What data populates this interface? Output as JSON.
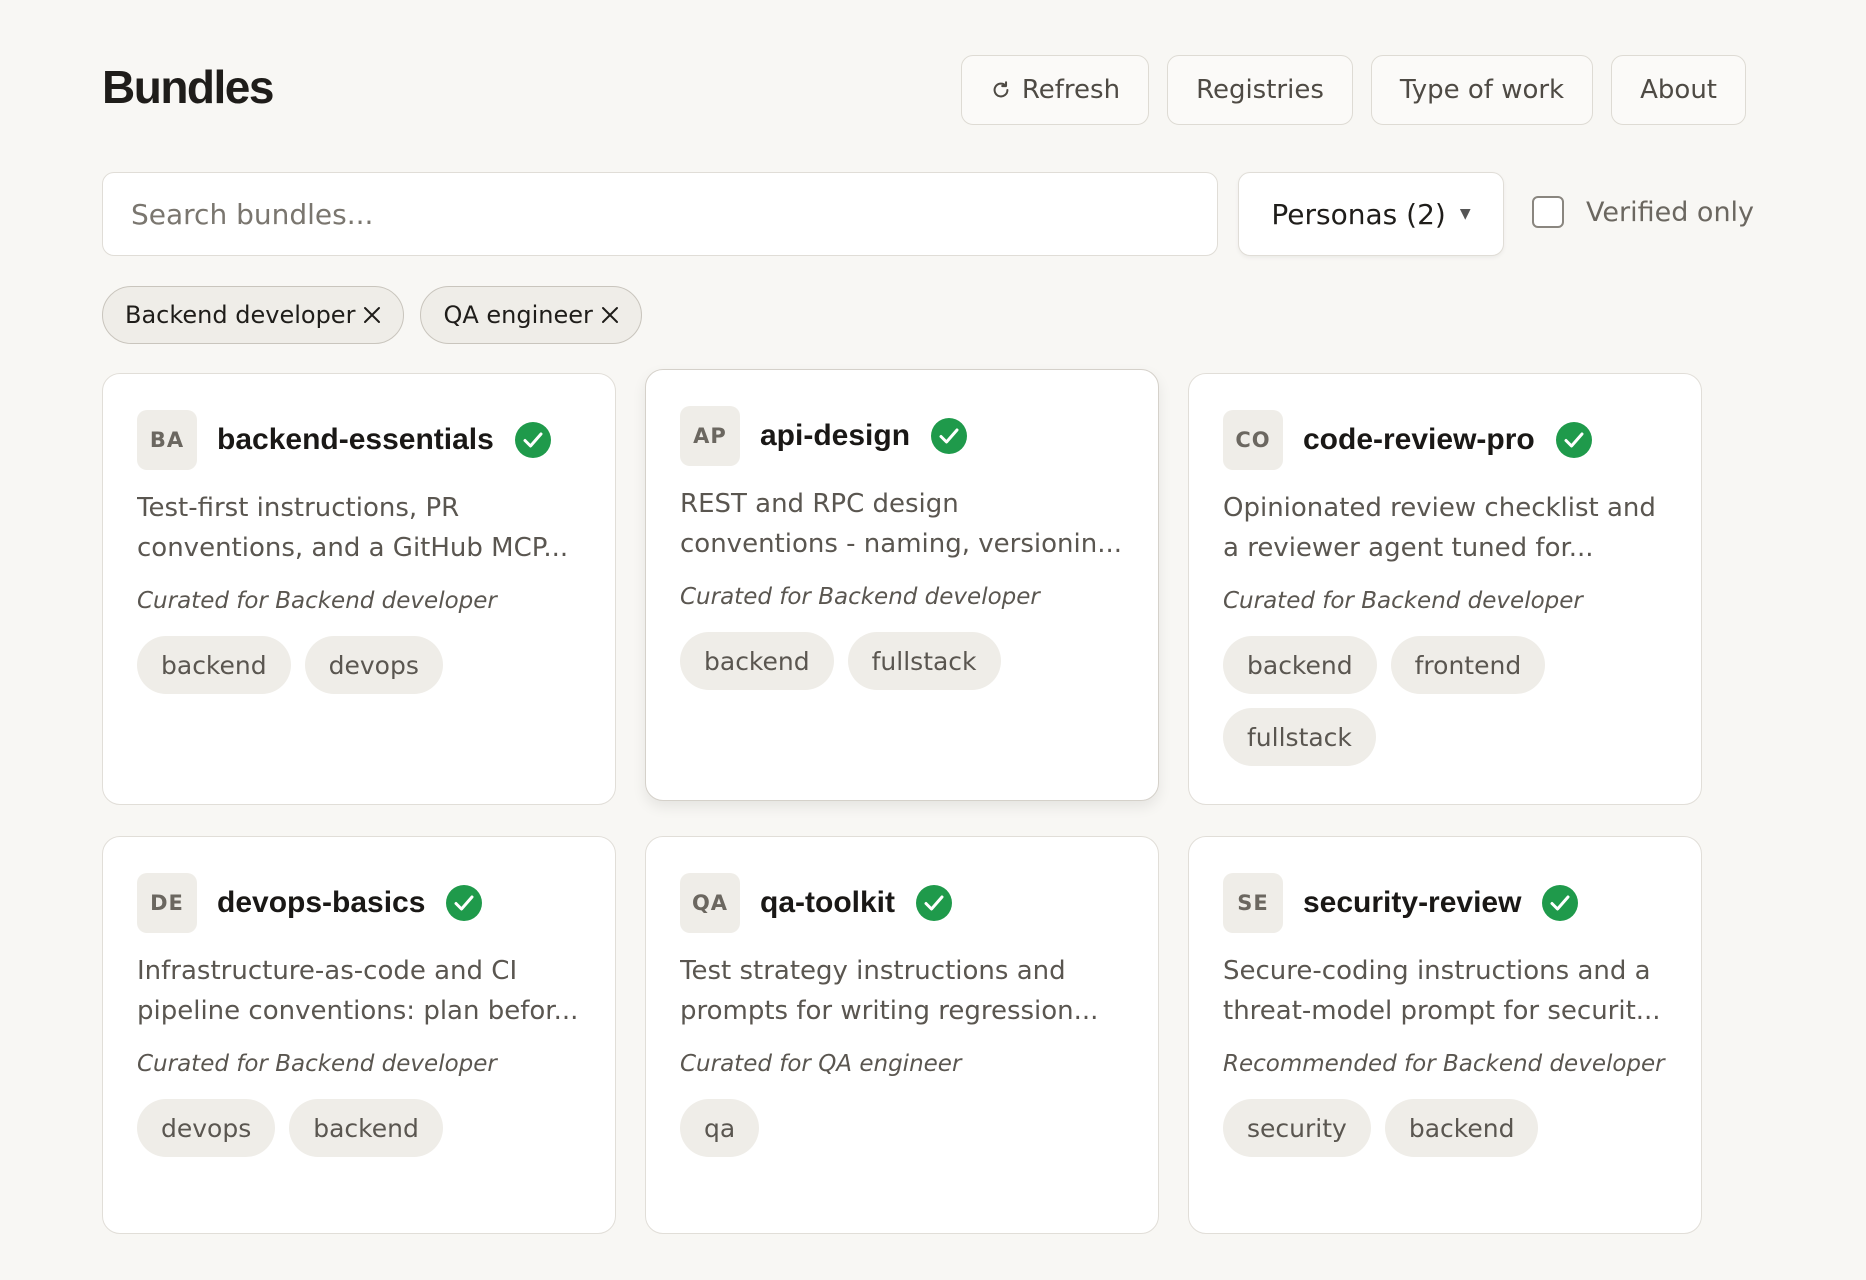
{
  "header": {
    "title": "Bundles",
    "buttons": {
      "refresh": "Refresh",
      "registries": "Registries",
      "type_of_work": "Type of work",
      "about": "About"
    }
  },
  "filters": {
    "search_placeholder": "Search bundles...",
    "personas_label": "Personas (2)",
    "verified_only_label": "Verified only",
    "verified_only_checked": false,
    "active_chips": [
      "Backend developer",
      "QA engineer"
    ]
  },
  "colors": {
    "verified_green": "#1f9a4b",
    "background": "#f8f7f4"
  },
  "bundles": [
    {
      "initials": "BA",
      "name": "backend-essentials",
      "verified": true,
      "description": "Test-first instructions, PR conventions, and a GitHub MCP...",
      "curated": "Curated for Backend developer",
      "tags": [
        "backend",
        "devops"
      ]
    },
    {
      "initials": "AP",
      "name": "api-design",
      "verified": true,
      "description": "REST and RPC design conventions - naming, versionin...",
      "curated": "Curated for Backend developer",
      "tags": [
        "backend",
        "fullstack"
      ]
    },
    {
      "initials": "CO",
      "name": "code-review-pro",
      "verified": true,
      "description": "Opinionated review checklist and a reviewer agent tuned for...",
      "curated": "Curated for Backend developer",
      "tags": [
        "backend",
        "frontend",
        "fullstack"
      ]
    },
    {
      "initials": "DE",
      "name": "devops-basics",
      "verified": true,
      "description": "Infrastructure-as-code and CI pipeline conventions: plan befor...",
      "curated": "Curated for Backend developer",
      "tags": [
        "devops",
        "backend"
      ]
    },
    {
      "initials": "QA",
      "name": "qa-toolkit",
      "verified": true,
      "description": "Test strategy instructions and prompts for writing regression...",
      "curated": "Curated for QA engineer",
      "tags": [
        "qa"
      ]
    },
    {
      "initials": "SE",
      "name": "security-review",
      "verified": true,
      "description": "Secure-coding instructions and a threat-model prompt for securit...",
      "curated": "Recommended for Backend developer",
      "tags": [
        "security",
        "backend"
      ]
    }
  ]
}
